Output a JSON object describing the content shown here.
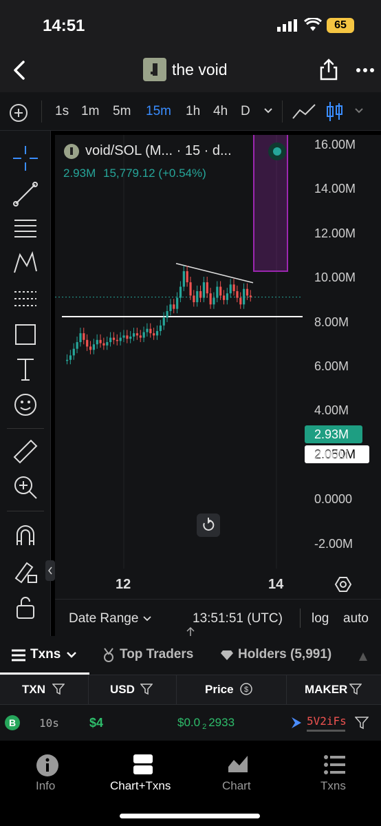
{
  "status": {
    "time": "14:51",
    "battery": "65"
  },
  "header": {
    "title": "the void"
  },
  "timeframes": {
    "items": [
      "1s",
      "1m",
      "5m",
      "15m",
      "1h",
      "4h",
      "D"
    ],
    "active": "15m"
  },
  "chart": {
    "symbol_title": "void/SOL (M... · 15 · d...",
    "last_price": "2.93M",
    "ohlc": "15,779.12 (+0.54%)",
    "price_label": "2.93M",
    "hline_label": "2.050M",
    "y_ticks": [
      "16.00M",
      "14.00M",
      "12.00M",
      "10.00M",
      "8.00M",
      "6.00M",
      "4.00M",
      "2.00M",
      "0.0000",
      "-2.00M"
    ],
    "x_ticks": [
      "12",
      "14"
    ],
    "colors": {
      "up": "#26a69a",
      "down": "#ef5350",
      "box": "#9c27b0",
      "line": "#ffffff",
      "accent": "#1e9e82"
    }
  },
  "chart_data": {
    "type": "line",
    "x": [
      "12",
      "14"
    ],
    "y_range": [
      -2000000,
      16000000
    ],
    "series": [
      {
        "values": [
          2930000
        ]
      }
    ],
    "hline": 2050000
  },
  "bottom": {
    "date_range": "Date Range",
    "time": "13:51:51 (UTC)",
    "log": "log",
    "auto": "auto"
  },
  "tabs": {
    "txns": "Txns",
    "top_traders": "Top Traders",
    "holders": "Holders (5,991)"
  },
  "table": {
    "headers": [
      "TXN",
      "USD",
      "Price",
      "MAKER"
    ],
    "rows": [
      {
        "badge": "B",
        "age": "10s",
        "usd": "$4",
        "price_prefix": "$0.0",
        "price_sub": "2",
        "price_suffix": "2933",
        "maker": "5V2iFs"
      }
    ]
  },
  "nav": {
    "items": [
      "Info",
      "Chart+Txns",
      "Chart",
      "Txns"
    ],
    "active": "Chart+Txns"
  }
}
